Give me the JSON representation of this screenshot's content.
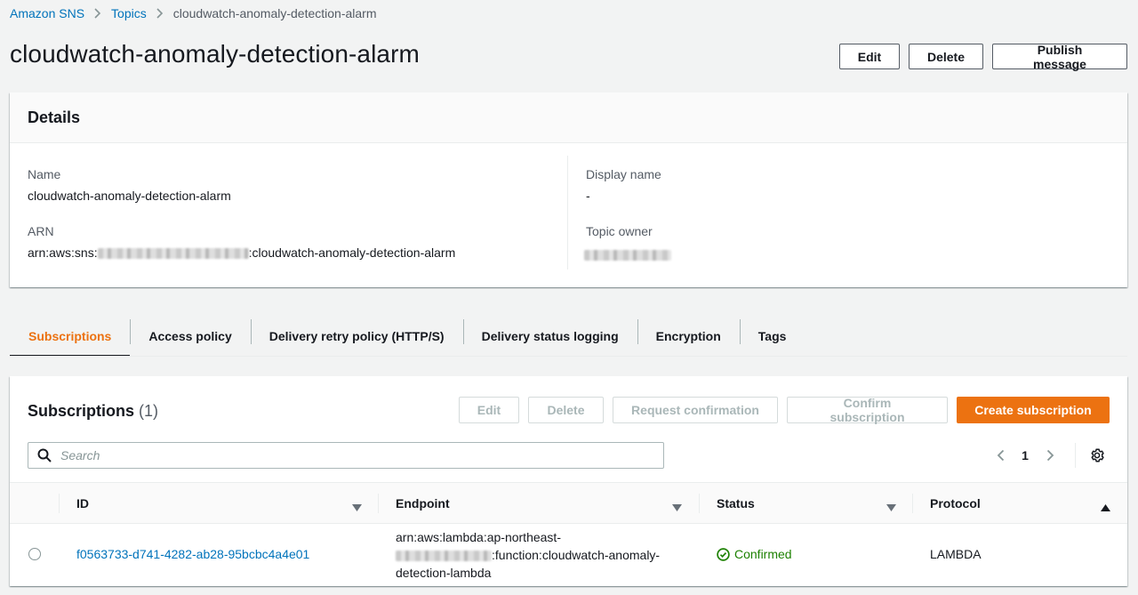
{
  "breadcrumb": {
    "items": [
      "Amazon SNS",
      "Topics"
    ],
    "current": "cloudwatch-anomaly-detection-alarm"
  },
  "header": {
    "title": "cloudwatch-anomaly-detection-alarm",
    "edit_label": "Edit",
    "delete_label": "Delete",
    "publish_label": "Publish message"
  },
  "details": {
    "title": "Details",
    "name_label": "Name",
    "name_value": "cloudwatch-anomaly-detection-alarm",
    "arn_label": "ARN",
    "arn_prefix": "arn:aws:sns:",
    "arn_suffix": ":cloudwatch-anomaly-detection-alarm",
    "display_name_label": "Display name",
    "display_name_value": "-",
    "topic_owner_label": "Topic owner"
  },
  "tabs": [
    {
      "label": "Subscriptions",
      "active": true
    },
    {
      "label": "Access policy"
    },
    {
      "label": "Delivery retry policy (HTTP/S)"
    },
    {
      "label": "Delivery status logging"
    },
    {
      "label": "Encryption"
    },
    {
      "label": "Tags"
    }
  ],
  "subscriptions": {
    "title": "Subscriptions",
    "count": "(1)",
    "actions": {
      "edit": "Edit",
      "delete": "Delete",
      "request_confirmation": "Request confirmation",
      "confirm_subscription": "Confirm subscription",
      "create_subscription": "Create subscription"
    },
    "search_placeholder": "Search",
    "page": "1",
    "columns": [
      "ID",
      "Endpoint",
      "Status",
      "Protocol"
    ],
    "rows": [
      {
        "id": "f0563733-d741-4282-ab28-95bcbc4a4e01",
        "endpoint_line1": "arn:aws:lambda:ap-northeast-",
        "endpoint_line2_suffix": ":function:cloudwatch-anomaly-",
        "endpoint_line3": "detection-lambda",
        "status": "Confirmed",
        "protocol": "LAMBDA"
      }
    ]
  },
  "colors": {
    "link": "#0073bb",
    "accent": "#ec7211",
    "success": "#1d8102"
  },
  "icons": [
    "chevron-right-icon",
    "search-icon",
    "chevron-left-icon",
    "gear-icon",
    "sort-down-icon",
    "sort-up-icon",
    "check-circle-icon"
  ]
}
